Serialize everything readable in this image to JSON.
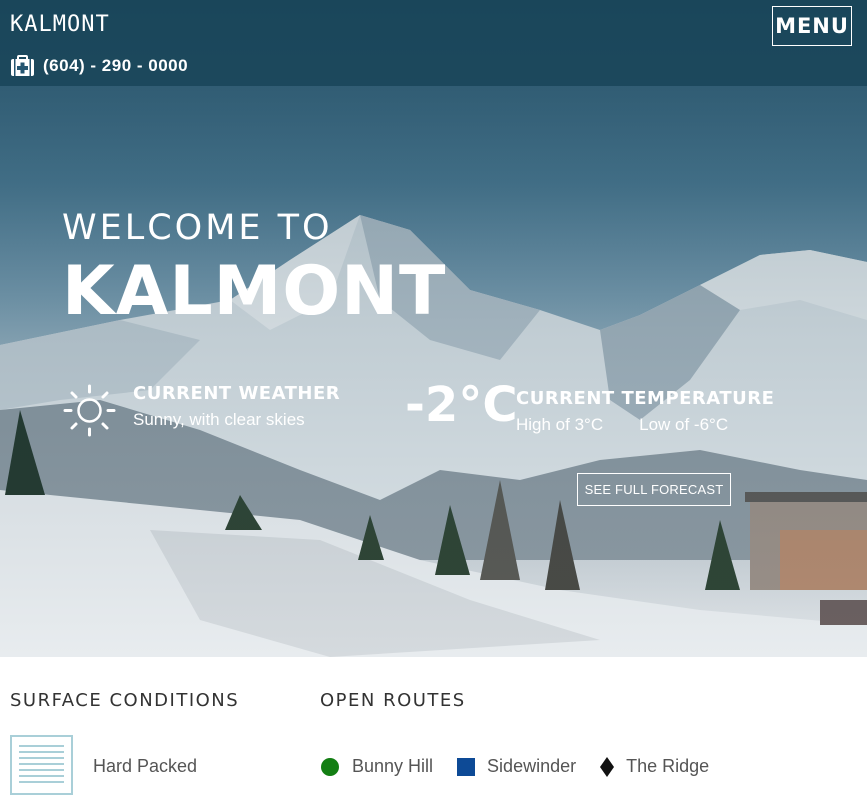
{
  "header": {
    "brand": "KALMONT",
    "phone": "(604) - 290 - 0000",
    "menu_label": "MENU"
  },
  "hero": {
    "welcome_line": "WELCOME TO",
    "welcome_name": "KALMONT",
    "weather": {
      "title": "CURRENT WEATHER",
      "description": "Sunny, with clear skies"
    },
    "temperature": {
      "value": "-2°C",
      "title": "CURRENT TEMPERATURE",
      "high": "High of 3°C",
      "low": "Low of -6°C"
    },
    "forecast_button": "SEE FULL FORECAST"
  },
  "surface": {
    "title": "SURFACE CONDITIONS",
    "condition": "Hard Packed"
  },
  "routes": {
    "title": "OPEN ROUTES",
    "items": [
      {
        "label": "Bunny Hill",
        "icon": "green-circle-icon",
        "color": "#137e13"
      },
      {
        "label": "Sidewinder",
        "icon": "blue-square-icon",
        "color": "#0d4a96"
      },
      {
        "label": "The Ridge",
        "icon": "black-diamond-icon",
        "color": "#111111"
      }
    ]
  },
  "colors": {
    "header_bg": "#184458",
    "accent_light": "#a9cfd8"
  }
}
